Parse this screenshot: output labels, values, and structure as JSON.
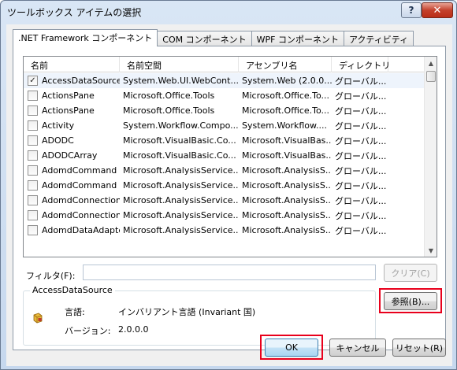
{
  "window": {
    "title": "ツールボックス アイテムの選択",
    "help_glyph": "?",
    "close_glyph": "✕"
  },
  "tabs": [
    {
      "label": ".NET Framework コンポーネント",
      "active": true
    },
    {
      "label": "COM コンポーネント",
      "active": false
    },
    {
      "label": "WPF コンポーネント",
      "active": false
    },
    {
      "label": "アクティビティ",
      "active": false
    }
  ],
  "list": {
    "columns": [
      "名前",
      "名前空間",
      "アセンブリ名",
      "ディレクトリ"
    ],
    "rows": [
      {
        "checked": true,
        "name": "AccessDataSource",
        "namespace": "System.Web.UI.WebCont...",
        "assembly": "System.Web (2.0.0....",
        "directory": "グローバル..."
      },
      {
        "checked": false,
        "name": "ActionsPane",
        "namespace": "Microsoft.Office.Tools",
        "assembly": "Microsoft.Office.To...",
        "directory": "グローバル..."
      },
      {
        "checked": false,
        "name": "ActionsPane",
        "namespace": "Microsoft.Office.Tools",
        "assembly": "Microsoft.Office.To...",
        "directory": "グローバル..."
      },
      {
        "checked": false,
        "name": "Activity",
        "namespace": "System.Workflow.Compo...",
        "assembly": "System.Workflow....",
        "directory": "グローバル..."
      },
      {
        "checked": false,
        "name": "ADODC",
        "namespace": "Microsoft.VisualBasic.Co...",
        "assembly": "Microsoft.VisualBas...",
        "directory": "グローバル..."
      },
      {
        "checked": false,
        "name": "ADODCArray",
        "namespace": "Microsoft.VisualBasic.Co...",
        "assembly": "Microsoft.VisualBas...",
        "directory": "グローバル..."
      },
      {
        "checked": false,
        "name": "AdomdCommand",
        "namespace": "Microsoft.AnalysisService...",
        "assembly": "Microsoft.AnalysisS...",
        "directory": "グローバル..."
      },
      {
        "checked": false,
        "name": "AdomdCommand",
        "namespace": "Microsoft.AnalysisService...",
        "assembly": "Microsoft.AnalysisS...",
        "directory": "グローバル..."
      },
      {
        "checked": false,
        "name": "AdomdConnection",
        "namespace": "Microsoft.AnalysisService...",
        "assembly": "Microsoft.AnalysisS...",
        "directory": "グローバル..."
      },
      {
        "checked": false,
        "name": "AdomdConnection",
        "namespace": "Microsoft.AnalysisService...",
        "assembly": "Microsoft.AnalysisS...",
        "directory": "グローバル..."
      },
      {
        "checked": false,
        "name": "AdomdDataAdapter",
        "namespace": "Microsoft.AnalysisService...",
        "assembly": "Microsoft.AnalysisS...",
        "directory": "グローバル..."
      }
    ],
    "checkmark_glyph": "✓"
  },
  "filter": {
    "label": "フィルタ(F):",
    "value": "",
    "clear_label": "クリア(C)"
  },
  "details": {
    "group_title": "AccessDataSource",
    "language_label": "言語:",
    "language_value": "インバリアント言語 (Invariant 国)",
    "version_label": "バージョン:",
    "version_value": "2.0.0.0",
    "browse_label": "参照(B)..."
  },
  "footer": {
    "ok_label": "OK",
    "cancel_label": "キャンセル",
    "reset_label": "リセット(R)"
  },
  "colors": {
    "highlight": "#e8001c",
    "titlebar": "#c6d8ee"
  },
  "icons": {
    "component": "component-icon",
    "scroll_up": "scroll-up-arrow-icon",
    "scroll_down": "scroll-down-arrow-icon"
  }
}
